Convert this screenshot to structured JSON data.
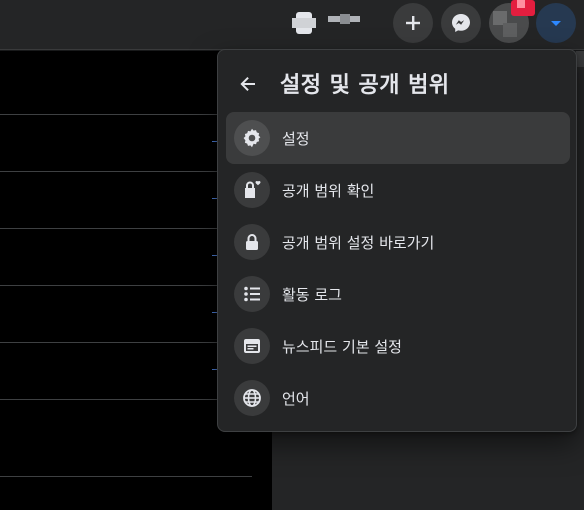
{
  "menu": {
    "title": "설정 및 공개 범위",
    "items": [
      {
        "label": "설정",
        "icon": "gear-icon"
      },
      {
        "label": "공개 범위 확인",
        "icon": "lock-heart-icon"
      },
      {
        "label": "공개 범위 설정 바로가기",
        "icon": "lock-icon"
      },
      {
        "label": "활동 로그",
        "icon": "list-icon"
      },
      {
        "label": "뉴스피드 기본 설정",
        "icon": "feed-window-icon"
      },
      {
        "label": "언어",
        "icon": "globe-icon"
      }
    ]
  },
  "colors": {
    "menu_bg": "#242526",
    "hover_bg": "#3a3b3c",
    "text": "#e4e6eb",
    "accent": "#2d88ff",
    "notification": "#e41e3f"
  }
}
